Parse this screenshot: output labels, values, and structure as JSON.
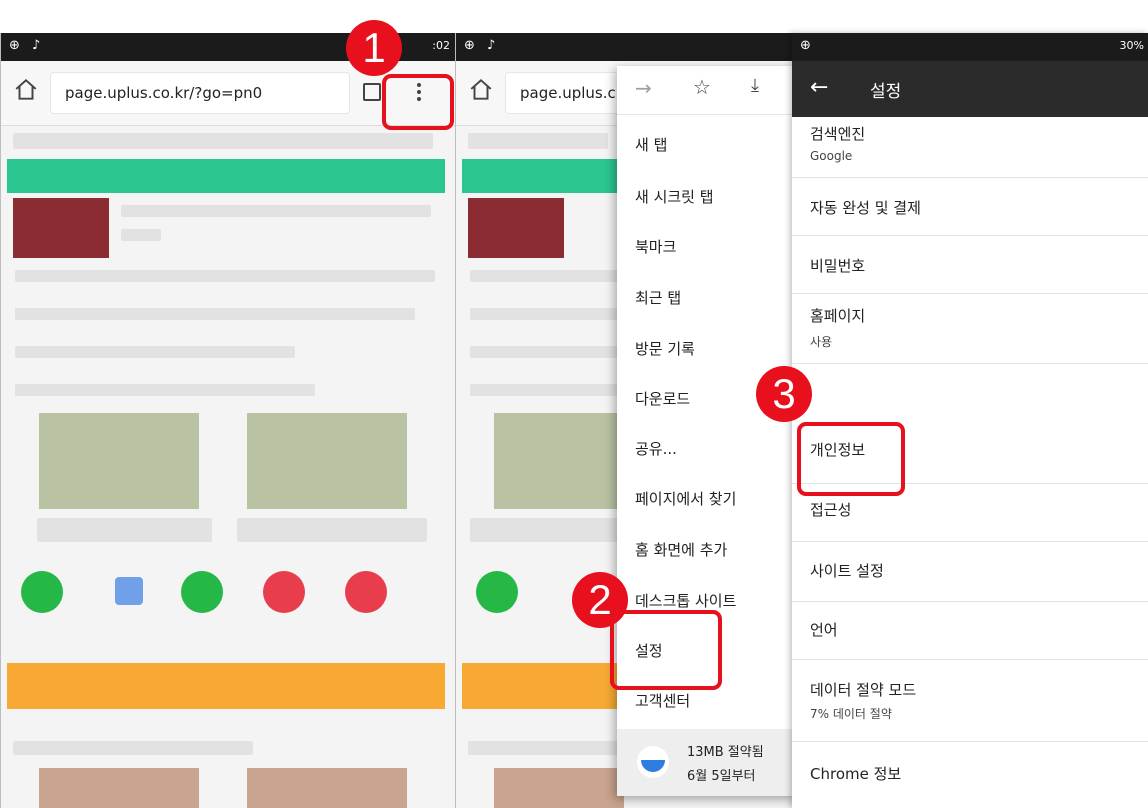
{
  "panel1": {
    "status_time": ":02",
    "url": "page.uplus.co.kr/?go=pn0"
  },
  "panel2": {
    "url": "page.uplus.c",
    "menu": {
      "items": [
        "새 탭",
        "새 시크릿 탭",
        "북마크",
        "최근 탭",
        "방문 기록",
        "다운로드",
        "공유...",
        "페이지에서 찾기",
        "홈 화면에 추가",
        "데스크톱 사이트",
        "설정",
        "고객센터"
      ],
      "footer_line1": "13MB 절약됨",
      "footer_line2": "6월 5일부터"
    }
  },
  "settings": {
    "status_battery": "30%",
    "title": "설정",
    "rows": [
      {
        "title": "검색엔진",
        "sub": "Google"
      },
      {
        "title": "자동 완성 및 결제",
        "sub": ""
      },
      {
        "title": "비밀번호",
        "sub": ""
      },
      {
        "title": "홈페이지",
        "sub": "사용"
      },
      {
        "title": "개인정보",
        "sub": ""
      },
      {
        "title": "접근성",
        "sub": ""
      },
      {
        "title": "사이트 설정",
        "sub": ""
      },
      {
        "title": "언어",
        "sub": ""
      },
      {
        "title": "데이터 절약 모드",
        "sub": "7% 데이터 절약"
      },
      {
        "title": "Chrome 정보",
        "sub": ""
      }
    ]
  },
  "steps": [
    "1",
    "2",
    "3"
  ],
  "colors": {
    "accent_red": "#e8101d",
    "green": "#2bc58f",
    "orange": "#f7a934"
  }
}
